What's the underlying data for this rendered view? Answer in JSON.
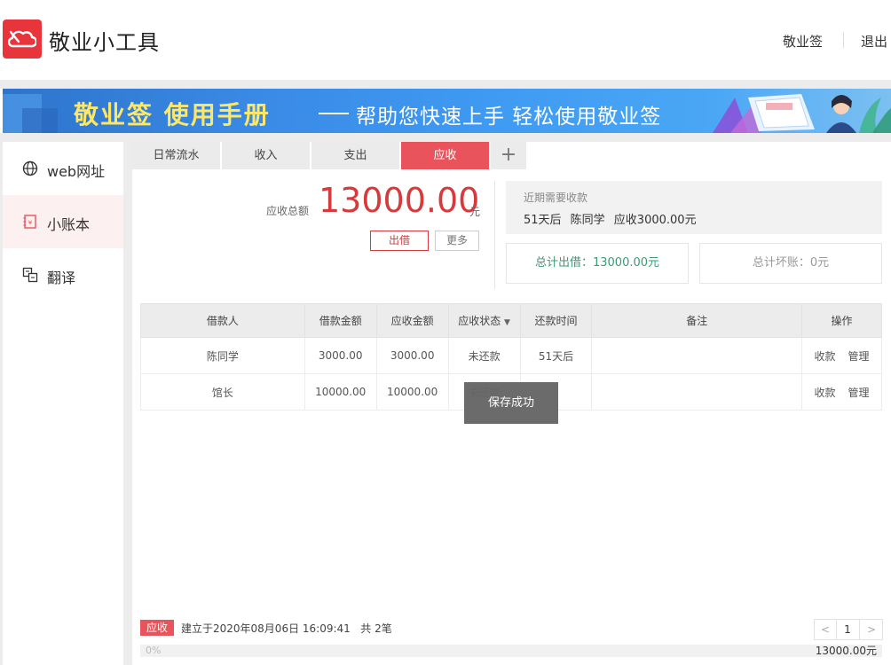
{
  "header": {
    "app_title": "敬业小工具",
    "link_app": "敬业签",
    "link_logout": "退出",
    "brand_color": "#e8353b"
  },
  "banner": {
    "title": "敬业签 使用手册",
    "subtitle": "帮助您快速上手  轻松使用敬业签"
  },
  "sidebar": {
    "items": [
      {
        "label": "web网址",
        "icon": "globe-icon"
      },
      {
        "label": "小账本",
        "icon": "ledger-icon"
      },
      {
        "label": "翻译",
        "icon": "translate-icon"
      }
    ],
    "active_index": 1
  },
  "tabs": [
    {
      "label": "日常流水"
    },
    {
      "label": "收入"
    },
    {
      "label": "支出"
    },
    {
      "label": "应收"
    }
  ],
  "active_tab_index": 3,
  "summary": {
    "label": "应收总额",
    "value": "13000.00",
    "unit": "元",
    "lend_button": "出借",
    "more_button": "更多"
  },
  "recent": {
    "title": "近期需要收款",
    "line": "51天后 陈同学 应收3000.00元"
  },
  "stats": {
    "total_lent": "总计出借：13000.00元",
    "bad_debt": "总计坏账：0元"
  },
  "table": {
    "headers": [
      "借款人",
      "借款金额",
      "应收金额",
      "应收状态",
      "还款时间",
      "备注",
      "操作"
    ],
    "rows": [
      {
        "borrower": "陈同学",
        "loan": "3000.00",
        "receivable": "3000.00",
        "status": "未还款",
        "due": "51天后",
        "note": "",
        "op1": "收款",
        "op2": "管理"
      },
      {
        "borrower": "馆长",
        "loan": "10000.00",
        "receivable": "10000.00",
        "status": "未还款",
        "due": "",
        "note": "",
        "op1": "收款",
        "op2": "管理"
      }
    ]
  },
  "toast": "保存成功",
  "footer": {
    "tag": "应收",
    "created": "建立于2020年08月06日 16:09:41",
    "count": "共 2笔",
    "page": "1",
    "prev": "<",
    "next": ">",
    "progress_pct": "0%",
    "progress_fraction": 0,
    "progress_amount": "13000.00元"
  }
}
